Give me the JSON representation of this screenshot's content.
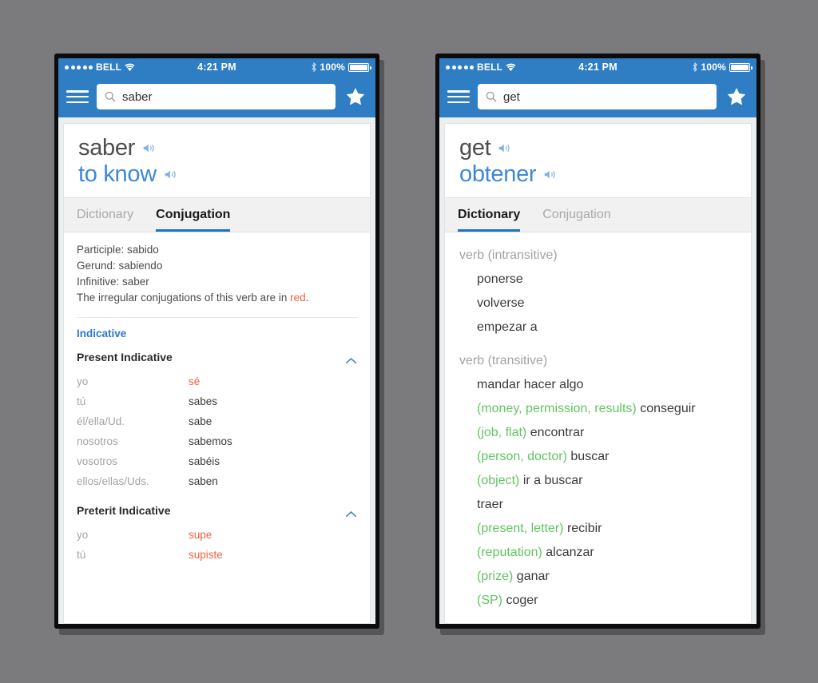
{
  "background_color": "#7b7a7d",
  "accent_blue": "#2f7ec4",
  "irregular_color": "#f2613f",
  "context_color": "#62c462",
  "status_bar": {
    "signal_dots": 5,
    "carrier": "BELL",
    "wifi_icon": "wifi-icon",
    "time": "4:21 PM",
    "bluetooth_icon": "bluetooth-icon",
    "battery_percent": "100%",
    "battery_icon": "battery-full-icon"
  },
  "phones": [
    {
      "id": "left",
      "nav": {
        "menu_icon": "hamburger-icon",
        "search_icon": "search-icon",
        "search_value": "saber",
        "search_placeholder": "Search",
        "favorite_icon": "star-icon"
      },
      "entry": {
        "headword": "saber",
        "translation": "to know",
        "speaker_icon": "speaker-icon"
      },
      "tabs": [
        {
          "label": "Dictionary",
          "active": false
        },
        {
          "label": "Conjugation",
          "active": true
        }
      ],
      "conjugation": {
        "participle_line": "Participle: sabido",
        "gerund_line": "Gerund: sabiendo",
        "infinitive_line": "Infinitive: saber",
        "note_prefix": "The irregular conjugations of this verb are in ",
        "note_highlight": "red",
        "note_suffix": ".",
        "mood": "Indicative",
        "tenses": [
          {
            "name": "Present Indicative",
            "collapse_icon": "chevron-up-icon",
            "rows": [
              {
                "pronoun": "yo",
                "form": "sé",
                "irregular": true
              },
              {
                "pronoun": "tú",
                "form": "sabes",
                "irregular": false
              },
              {
                "pronoun": "él/ella/Ud.",
                "form": "sabe",
                "irregular": false
              },
              {
                "pronoun": "nosotros",
                "form": "sabemos",
                "irregular": false
              },
              {
                "pronoun": "vosotros",
                "form": "sabéis",
                "irregular": false
              },
              {
                "pronoun": "ellos/ellas/Uds.",
                "form": "saben",
                "irregular": false
              }
            ]
          },
          {
            "name": "Preterit Indicative",
            "collapse_icon": "chevron-up-icon",
            "rows": [
              {
                "pronoun": "yo",
                "form": "supe",
                "irregular": true
              },
              {
                "pronoun": "tú",
                "form": "supiste",
                "irregular": true
              }
            ]
          }
        ]
      }
    },
    {
      "id": "right",
      "nav": {
        "menu_icon": "hamburger-icon",
        "search_icon": "search-icon",
        "search_value": "get",
        "search_placeholder": "Search",
        "favorite_icon": "star-icon"
      },
      "entry": {
        "headword": "get",
        "translation": "obtener",
        "speaker_icon": "speaker-icon"
      },
      "tabs": [
        {
          "label": "Dictionary",
          "active": true
        },
        {
          "label": "Conjugation",
          "active": false
        }
      ],
      "dictionary": {
        "groups": [
          {
            "pos": "verb (intransitive)",
            "senses": [
              {
                "context": "",
                "term": "ponerse"
              },
              {
                "context": "",
                "term": "volverse"
              },
              {
                "context": "",
                "term": "empezar a"
              }
            ]
          },
          {
            "pos": "verb (transitive)",
            "senses": [
              {
                "context": "",
                "term": "mandar hacer algo"
              },
              {
                "context": "(money, permission, results)",
                "term": "conseguir"
              },
              {
                "context": "(job, flat)",
                "term": "encontrar"
              },
              {
                "context": "(person, doctor)",
                "term": "buscar"
              },
              {
                "context": "(object)",
                "term": "ir a buscar"
              },
              {
                "context": "",
                "term": "traer"
              },
              {
                "context": "(present, letter)",
                "term": "recibir"
              },
              {
                "context": "(reputation)",
                "term": "alcanzar"
              },
              {
                "context": "(prize)",
                "term": "ganar"
              },
              {
                "context": "(SP)",
                "term": "coger"
              }
            ]
          }
        ]
      }
    }
  ]
}
